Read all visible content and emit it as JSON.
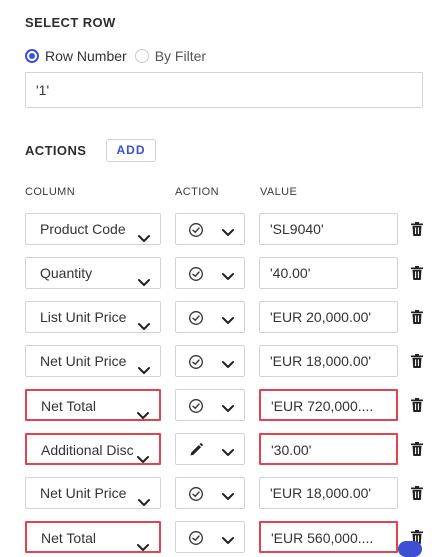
{
  "select_row": {
    "title": "SELECT ROW",
    "radio_row_number": "Row Number",
    "radio_by_filter": "By Filter",
    "row_value": "'1'"
  },
  "actions": {
    "title": "ACTIONS",
    "add_label": "ADD",
    "headers": {
      "column": "COLUMN",
      "action": "ACTION",
      "value": "VALUE"
    },
    "rows": [
      {
        "column": "Product Code",
        "action": "check",
        "value": "'SL9040'",
        "highlighted": false
      },
      {
        "column": "Quantity",
        "action": "check",
        "value": "'40.00'",
        "highlighted": false
      },
      {
        "column": "List Unit Price",
        "action": "check",
        "value": "'EUR 20,000.00'",
        "highlighted": false
      },
      {
        "column": "Net Unit Price",
        "action": "check",
        "value": "'EUR 18,000.00'",
        "highlighted": false
      },
      {
        "column": "Net Total",
        "action": "check",
        "value": "'EUR 720,000....",
        "highlighted": true
      },
      {
        "column": "Additional Disc",
        "action": "pencil",
        "value": "'30.00'",
        "highlighted": true
      },
      {
        "column": "Net Unit Price",
        "action": "check",
        "value": "'EUR 18,000.00'",
        "highlighted": false
      },
      {
        "column": "Net Total",
        "action": "check",
        "value": "'EUR 560,000....",
        "highlighted": true
      }
    ]
  },
  "colors": {
    "accent": "#3e4fd3",
    "highlight": "#e0444f",
    "border": "#cfd3da"
  }
}
